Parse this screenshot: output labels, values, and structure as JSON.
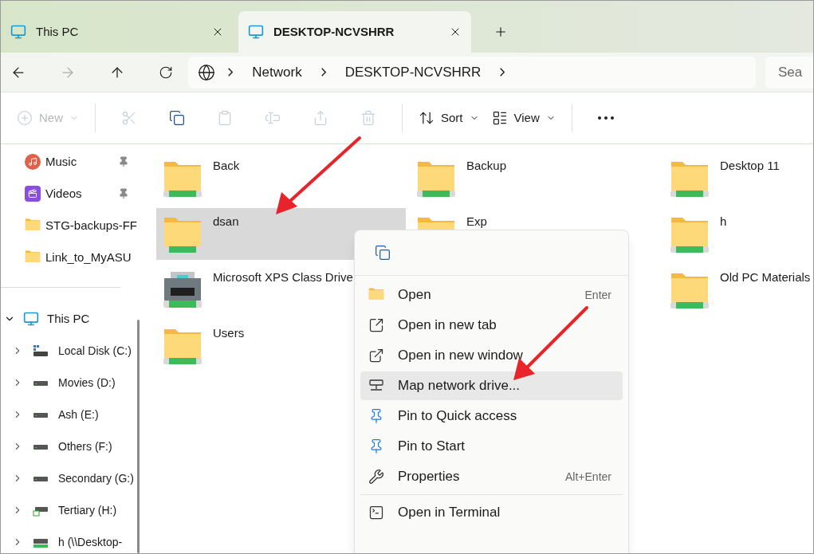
{
  "tabs": [
    {
      "label": "This PC",
      "selected": false
    },
    {
      "label": "DESKTOP-NCVSHRR",
      "selected": true
    }
  ],
  "address": {
    "crumbs": [
      "Network",
      "DESKTOP-NCVSHRR"
    ],
    "search_placeholder": "Sea"
  },
  "toolbar": [
    {
      "kind": "new",
      "label": "New",
      "disabled": true
    },
    {
      "kind": "cut",
      "disabled": true
    },
    {
      "kind": "copy",
      "disabled": false
    },
    {
      "kind": "paste",
      "disabled": true
    },
    {
      "kind": "rename",
      "disabled": true
    },
    {
      "kind": "share",
      "disabled": true
    },
    {
      "kind": "delete",
      "disabled": true
    },
    {
      "kind": "sort",
      "label": "Sort",
      "disabled": false
    },
    {
      "kind": "view",
      "label": "View",
      "disabled": false
    },
    {
      "kind": "more",
      "disabled": false
    }
  ],
  "sidebar": {
    "quick_access": [
      {
        "kind": "music",
        "label": "Music",
        "pinned": true
      },
      {
        "kind": "videos",
        "label": "Videos",
        "pinned": true
      },
      {
        "kind": "folder",
        "label": "STG-backups-FF",
        "pinned": false
      },
      {
        "kind": "folder",
        "label": "Link_to_MyASU",
        "pinned": false
      }
    ],
    "tree": [
      {
        "kind": "pc",
        "label": "This PC",
        "expanded": true,
        "children": [
          {
            "kind": "system-drive",
            "label": "Local Disk (C:)",
            "expanded": false
          },
          {
            "kind": "drive",
            "label": "Movies (D:)",
            "expanded": false
          },
          {
            "kind": "drive",
            "label": "Ash (E:)",
            "expanded": false
          },
          {
            "kind": "drive",
            "label": "Others (F:)",
            "expanded": false
          },
          {
            "kind": "drive",
            "label": "Secondary (G:)",
            "expanded": false
          },
          {
            "kind": "shortcut-drive",
            "label": "Tertiary (H:)",
            "expanded": false
          },
          {
            "kind": "network-drive",
            "label": "h (\\\\Desktop-",
            "expanded": false
          }
        ]
      }
    ]
  },
  "items": [
    {
      "kind": "folder",
      "name": "Back",
      "selected": false
    },
    {
      "kind": "folder",
      "name": "Backup",
      "selected": false
    },
    {
      "kind": "folder",
      "name": "Desktop 11",
      "selected": false
    },
    {
      "kind": "folder",
      "name": "dsan",
      "selected": true
    },
    {
      "kind": "folder",
      "name": "Exp",
      "selected": false
    },
    {
      "kind": "folder",
      "name": "h",
      "selected": false
    },
    {
      "kind": "printer",
      "name": "Microsoft XPS Class Drive",
      "selected": false
    },
    {
      "kind": "hidden"
    },
    {
      "kind": "folder",
      "name": "Old PC Materials",
      "selected": false
    },
    {
      "kind": "folder",
      "name": "Users",
      "selected": false
    }
  ],
  "context_menu": {
    "top_actions": [
      {
        "kind": "copy"
      }
    ],
    "items": [
      {
        "kind": "open",
        "label": "Open",
        "shortcut": "Enter",
        "selected": false
      },
      {
        "kind": "new-tab",
        "label": "Open in new tab",
        "selected": false
      },
      {
        "kind": "new-window",
        "label": "Open in new window",
        "selected": false
      },
      {
        "kind": "map-drive",
        "label": "Map network drive...",
        "selected": true
      },
      {
        "kind": "pin",
        "label": "Pin to Quick access",
        "selected": false
      },
      {
        "kind": "pin",
        "label": "Pin to Start",
        "selected": false
      },
      {
        "kind": "properties",
        "label": "Properties",
        "shortcut": "Alt+Enter",
        "selected": false
      },
      {
        "kind": "separator"
      },
      {
        "kind": "terminal",
        "label": "Open in Terminal",
        "selected": false
      }
    ]
  }
}
